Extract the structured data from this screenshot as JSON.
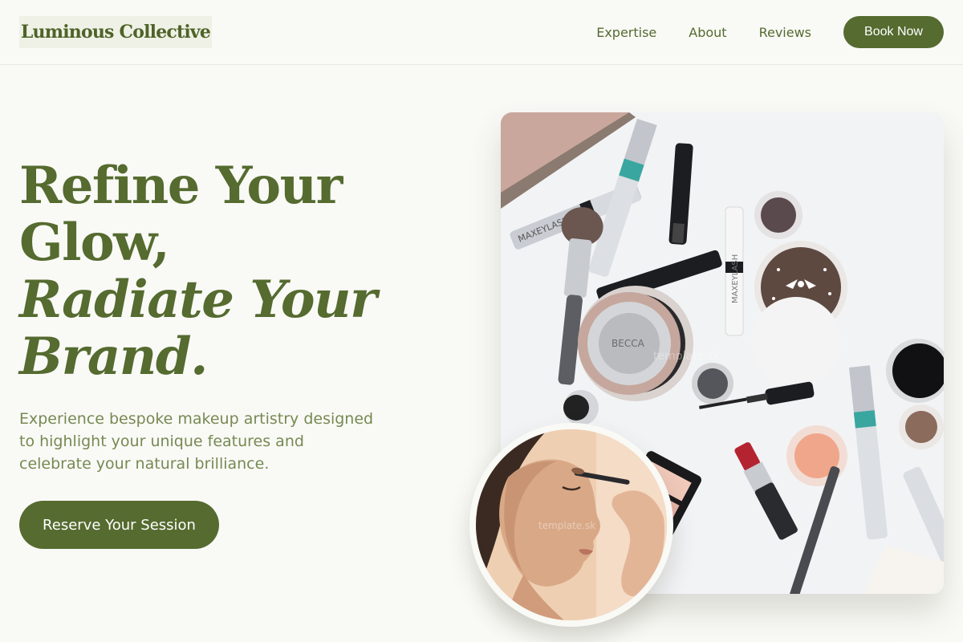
{
  "header": {
    "logo": "Luminous Collective",
    "nav": [
      "Expertise",
      "About",
      "Reviews"
    ],
    "cta": "Book Now"
  },
  "hero": {
    "title_line1": "Refine Your",
    "title_line2": "Glow,",
    "title_line3": "Radiate Your",
    "title_line4": "Brand.",
    "description": "Experience bespoke makeup artistry designed to highlight your unique features and celebrate your natural brilliance.",
    "cta": "Reserve Your Session"
  },
  "product_labels": {
    "mascara1": "MAXEYLASH",
    "mascara2": "MAXEYGROW",
    "compact": "BECCA",
    "watermark": "template.sk"
  },
  "colors": {
    "brand_green": "#556b2f",
    "background": "#f9f9f6",
    "text_muted": "#768a52"
  },
  "icons": {
    "image_main": "makeup-products-flatlay",
    "image_circle": "makeup-application-portrait"
  }
}
